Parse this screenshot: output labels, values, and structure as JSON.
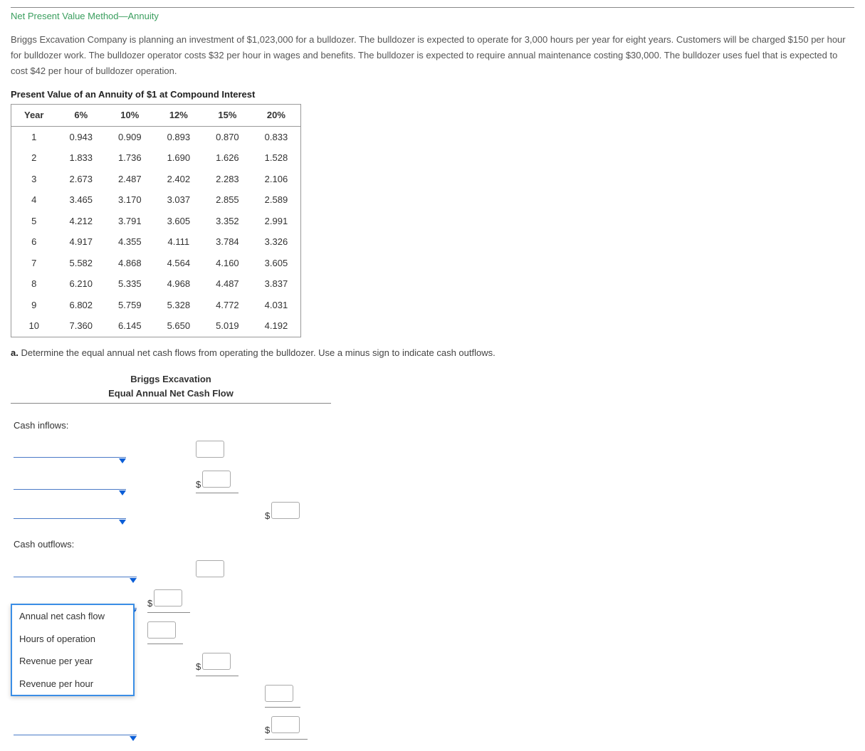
{
  "title": "Net Present Value Method—Annuity",
  "problem_text": "Briggs Excavation Company is planning an investment of $1,023,000 for a bulldozer. The bulldozer is expected to operate for 3,000 hours per year for eight years. Customers will be charged $150 per hour for bulldozer work. The bulldozer operator costs $32 per hour in wages and benefits. The bulldozer is expected to require annual maintenance costing $30,000. The bulldozer uses fuel that is expected to cost $42 per hour of bulldozer operation.",
  "annuity_title": "Present Value of an Annuity of $1 at Compound Interest",
  "annuity_headers": [
    "Year",
    "6%",
    "10%",
    "12%",
    "15%",
    "20%"
  ],
  "annuity_rows": [
    [
      "1",
      "0.943",
      "0.909",
      "0.893",
      "0.870",
      "0.833"
    ],
    [
      "2",
      "1.833",
      "1.736",
      "1.690",
      "1.626",
      "1.528"
    ],
    [
      "3",
      "2.673",
      "2.487",
      "2.402",
      "2.283",
      "2.106"
    ],
    [
      "4",
      "3.465",
      "3.170",
      "3.037",
      "2.855",
      "2.589"
    ],
    [
      "5",
      "4.212",
      "3.791",
      "3.605",
      "3.352",
      "2.991"
    ],
    [
      "6",
      "4.917",
      "4.355",
      "4.111",
      "3.784",
      "3.326"
    ],
    [
      "7",
      "5.582",
      "4.868",
      "4.564",
      "4.160",
      "3.605"
    ],
    [
      "8",
      "6.210",
      "5.335",
      "4.968",
      "4.487",
      "3.837"
    ],
    [
      "9",
      "6.802",
      "5.759",
      "5.328",
      "4.772",
      "4.031"
    ],
    [
      "10",
      "7.360",
      "6.145",
      "5.650",
      "5.019",
      "4.192"
    ]
  ],
  "part_a_label": "a.",
  "part_a_text": "Determine the equal annual net cash flows from operating the bulldozer. Use a minus sign to indicate cash outflows.",
  "cashflow": {
    "company": "Briggs Excavation",
    "subtitle": "Equal Annual Net Cash Flow",
    "inflows_label": "Cash inflows:",
    "outflows_label": "Cash outflows:"
  },
  "dropdown_options": [
    "Annual net cash flow",
    "Hours of operation",
    "Revenue per year",
    "Revenue per hour"
  ]
}
